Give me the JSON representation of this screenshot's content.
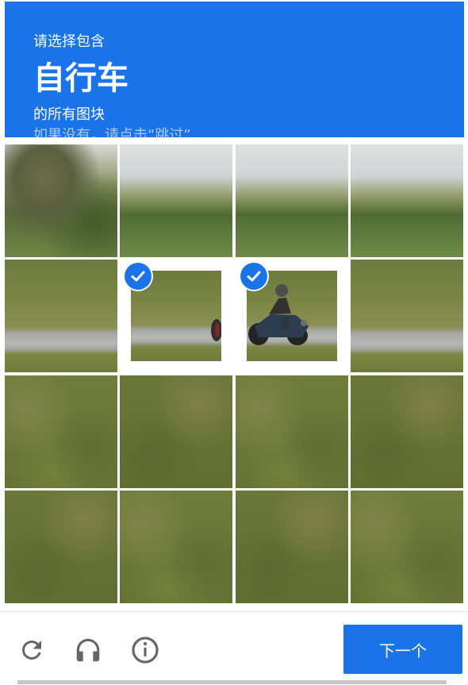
{
  "captcha": {
    "instruction_top": "请选择包含",
    "target_object": "自行车",
    "instruction_bottom": "的所有图块",
    "hint": "如果没有，请点击“跳过”",
    "next_button": "下一个",
    "icons": {
      "refresh": "refresh-icon",
      "audio": "headphones-icon",
      "info": "info-icon"
    },
    "selected_tiles": [
      5,
      6
    ],
    "tiles": [
      {
        "index": 0,
        "selected": false
      },
      {
        "index": 1,
        "selected": false
      },
      {
        "index": 2,
        "selected": false
      },
      {
        "index": 3,
        "selected": false
      },
      {
        "index": 4,
        "selected": false
      },
      {
        "index": 5,
        "selected": true
      },
      {
        "index": 6,
        "selected": true
      },
      {
        "index": 7,
        "selected": false
      },
      {
        "index": 8,
        "selected": false
      },
      {
        "index": 9,
        "selected": false
      },
      {
        "index": 10,
        "selected": false
      },
      {
        "index": 11,
        "selected": false
      },
      {
        "index": 12,
        "selected": false
      },
      {
        "index": 13,
        "selected": false
      },
      {
        "index": 14,
        "selected": false
      },
      {
        "index": 15,
        "selected": false
      }
    ]
  },
  "colors": {
    "accent": "#1a73e8",
    "header_text": "#ffffff",
    "icon_gray": "#666666"
  }
}
